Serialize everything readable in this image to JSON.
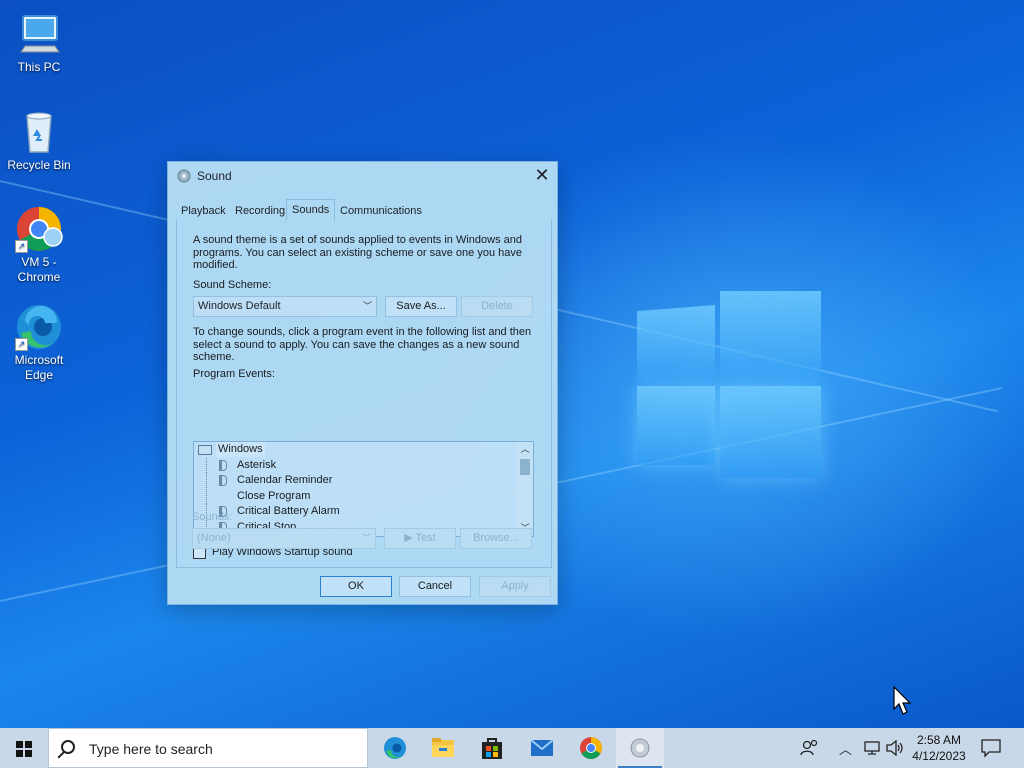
{
  "desktop": {
    "icons": [
      {
        "label": "This PC",
        "icon": "this-pc-icon"
      },
      {
        "label": "Recycle Bin",
        "icon": "recycle-bin-icon"
      },
      {
        "label": "VM 5 -\nChrome",
        "icon": "chrome-icon"
      },
      {
        "label": "Microsoft\nEdge",
        "icon": "edge-icon"
      }
    ]
  },
  "dialog": {
    "title": "Sound",
    "close_glyph": "✕",
    "tabs": [
      "Playback",
      "Recording",
      "Sounds",
      "Communications"
    ],
    "active_tab": "Sounds",
    "intro_text": "A sound theme is a set of sounds applied to events in Windows and programs.  You can select an existing scheme or save one you have modified.",
    "scheme_label": "Sound Scheme:",
    "scheme_value": "Windows Default",
    "save_as_label": "Save As...",
    "delete_label": "Delete",
    "change_text": "To change sounds, click a program event in the following list and then select a sound to apply.  You can save the changes as a new sound scheme.",
    "program_events_label": "Program Events:",
    "events": [
      {
        "label": "Windows",
        "type": "group"
      },
      {
        "label": "Asterisk",
        "has_sound": true
      },
      {
        "label": "Calendar Reminder",
        "has_sound": true
      },
      {
        "label": "Close Program",
        "has_sound": false
      },
      {
        "label": "Critical Battery Alarm",
        "has_sound": true
      },
      {
        "label": "Critical Stop",
        "has_sound": true
      }
    ],
    "startup_label": "Play Windows Startup sound",
    "startup_checked": false,
    "sounds_label": "Sounds:",
    "sounds_value": "(None)",
    "test_label": "▶ Test",
    "browse_label": "Browse...",
    "ok_label": "OK",
    "cancel_label": "Cancel",
    "apply_label": "Apply"
  },
  "taskbar": {
    "search_placeholder": "Type here to search",
    "apps": [
      "edge-icon",
      "file-explorer-icon",
      "store-icon",
      "mail-icon",
      "chrome-icon",
      "sound-settings-icon"
    ],
    "time": "2:58 AM",
    "date": "4/12/2023",
    "tray": {
      "chevron": "^",
      "network": "network-icon",
      "volume": "volume-icon"
    }
  },
  "colors": {
    "desktop_blue": "#0c63d8",
    "dialog_bg": "#b3dcf5",
    "taskbar_bg": "#c9d8e8"
  }
}
